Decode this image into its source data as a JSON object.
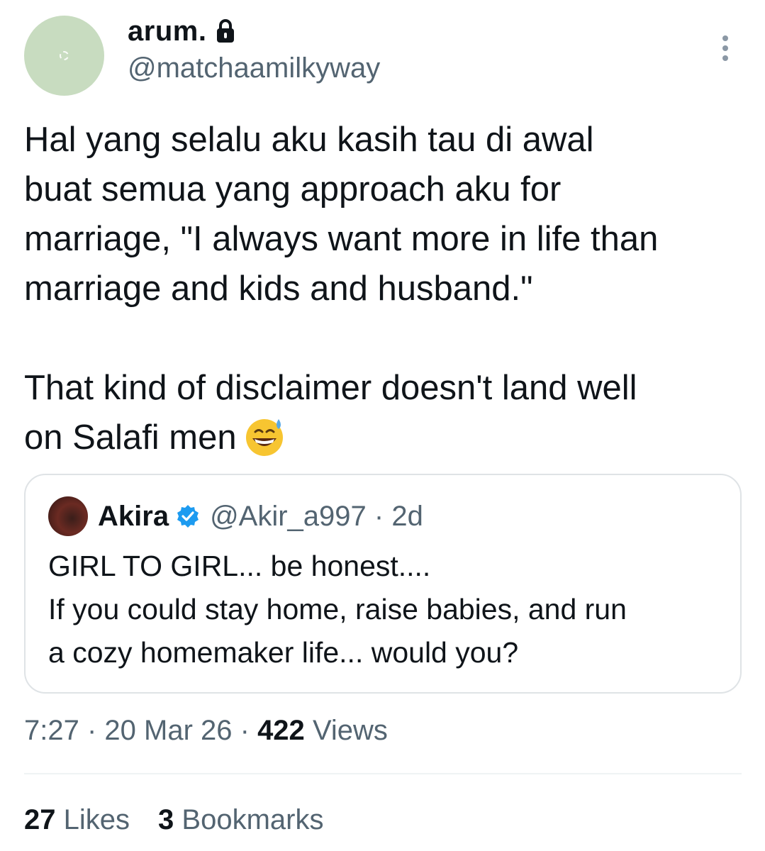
{
  "author": {
    "display_name": "arum.",
    "handle": "@matchaamilkyway",
    "avatar_color": "#c8dcc0",
    "locked": true
  },
  "tweet": {
    "text": "Hal yang selalu aku kasih tau di awal\nbuat semua yang approach aku for\nmarriage, \"I always want more in life than\nmarriage and kids and husband.\"\n\nThat kind of disclaimer doesn't land well\non Salafi men",
    "emoji": "grinning-face-with-sweat"
  },
  "quote": {
    "name": "Akira",
    "handle": "@Akir_a997",
    "time": "2d",
    "verified": true,
    "text": "GIRL TO GIRL... be honest....\nIf you could stay home, raise babies, and run\na cozy homemaker life... would you?"
  },
  "meta": {
    "time": "7:27",
    "date": "20 Mar 26",
    "views_count": "422",
    "views_label": "Views"
  },
  "stats": {
    "likes_count": "27",
    "likes_label": "Likes",
    "bookmarks_count": "3",
    "bookmarks_label": "Bookmarks"
  },
  "colors": {
    "text": "#0f1419",
    "muted": "#536471",
    "verified": "#1d9bf0",
    "border": "#dfe3e6"
  }
}
